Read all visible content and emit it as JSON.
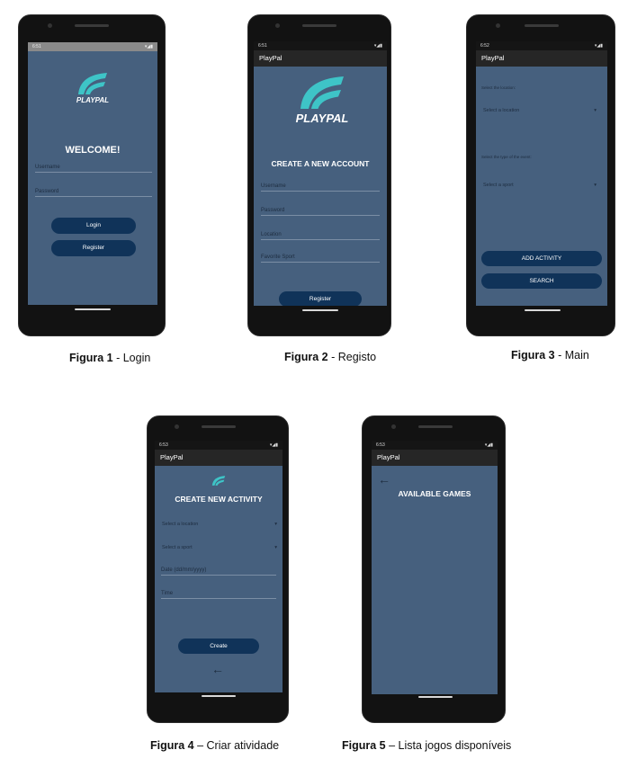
{
  "app_name": "PlayPal",
  "logo_text": "PLAYPAL",
  "colors": {
    "screen_bg": "#46607e",
    "button_bg": "#103359",
    "appbar_bg": "#262626",
    "logo_teal": "#3ec4c7"
  },
  "login": {
    "time": "6:51",
    "welcome": "WELCOME!",
    "username_label": "Username",
    "password_label": "Password",
    "login_button": "Login",
    "register_button": "Register",
    "caption_bold": "Figura 1",
    "caption_rest": " - Login"
  },
  "register": {
    "time": "6:51",
    "appbar_title": "PlayPal",
    "title": "CREATE A NEW ACCOUNT",
    "username_label": "Username",
    "password_label": "Password",
    "location_label": "Location",
    "sport_label": "Favorite Sport",
    "register_button": "Register",
    "caption_bold": "Figura 2",
    "caption_rest": " - Registo"
  },
  "main": {
    "time": "6:52",
    "appbar_title": "PlayPal",
    "location_hint": "Select the location:",
    "location_select": "Select a location",
    "sport_hint": "Select the type of the event:",
    "sport_select": "Select a sport",
    "add_button": "ADD ACTIVITY",
    "search_button": "SEARCH",
    "caption_bold": "Figura 3",
    "caption_rest": " - Main"
  },
  "create_activity": {
    "time": "6:53",
    "appbar_title": "PlayPal",
    "title": "CREATE NEW ACTIVITY",
    "location_select": "Select a location",
    "sport_select": "Select a sport",
    "date_label": "Date (dd/mm/yyyy)",
    "time_label": "Time",
    "create_button": "Create",
    "caption_bold": "Figura 4",
    "caption_rest": " – Criar atividade"
  },
  "available_games": {
    "time": "6:53",
    "appbar_title": "PlayPal",
    "title": "AVAILABLE GAMES",
    "caption_bold": "Figura 5",
    "caption_rest": " – Lista jogos disponíveis"
  }
}
